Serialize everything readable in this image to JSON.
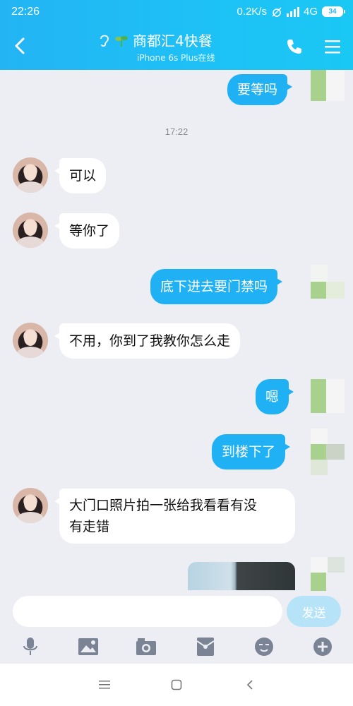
{
  "status": {
    "time": "22:26",
    "net_speed": "0.2K/s",
    "network": "4G",
    "battery": "34"
  },
  "header": {
    "title": "商都汇4快餐",
    "subtitle": "iPhone 6s Plus在线"
  },
  "messages": [
    {
      "side": "out",
      "text": "要等吗"
    },
    {
      "side": "in",
      "text": "可以"
    },
    {
      "side": "in",
      "text": "等你了"
    },
    {
      "side": "out",
      "text": "底下进去要门禁吗"
    },
    {
      "side": "in",
      "text": "不用，你到了我教你怎么走"
    },
    {
      "side": "out",
      "text": "嗯"
    },
    {
      "side": "out",
      "text": "到楼下了"
    },
    {
      "side": "in",
      "text": "大门口照片拍一张给我看看有没"
    },
    {
      "side": "in",
      "text": "有走错"
    }
  ],
  "timestamp": "17:22",
  "composer": {
    "placeholder": "",
    "send_label": "发送"
  },
  "colors": {
    "accent": "#1fb1f4",
    "header": "#23b4f4",
    "chat_bg": "#eceef3"
  }
}
